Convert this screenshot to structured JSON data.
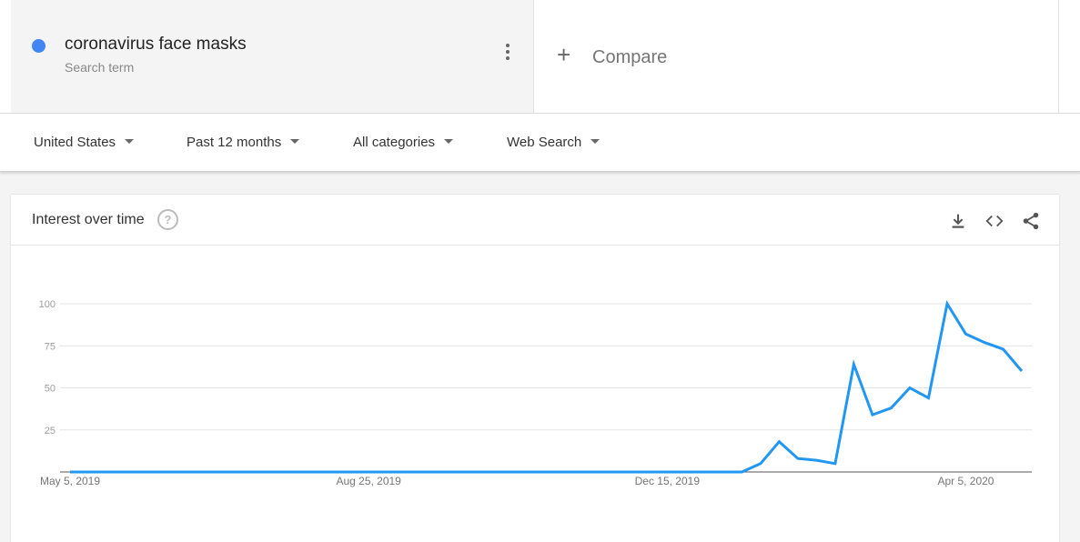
{
  "term": {
    "name": "coronavirus face masks",
    "sublabel": "Search term",
    "color": "#4285f4"
  },
  "compare": {
    "plus": "+",
    "label": "Compare"
  },
  "filters": [
    {
      "label": "United States"
    },
    {
      "label": "Past 12 months"
    },
    {
      "label": "All categories"
    },
    {
      "label": "Web Search"
    }
  ],
  "card": {
    "title": "Interest over time",
    "help_icon": "?",
    "icons": [
      "download-icon",
      "embed-code-icon",
      "share-icon"
    ]
  },
  "chart_data": {
    "type": "line",
    "title": "",
    "xlabel": "",
    "ylabel": "",
    "ylim": [
      0,
      100
    ],
    "yticks": [
      25,
      50,
      75,
      100
    ],
    "grid": true,
    "line_color": "#2196f3",
    "x_tick_labels": [
      {
        "label": "May 5, 2019",
        "index": 0
      },
      {
        "label": "Aug 25, 2019",
        "index": 16
      },
      {
        "label": "Dec 15, 2019",
        "index": 32
      },
      {
        "label": "Apr 5, 2020",
        "index": 48
      }
    ],
    "series": [
      {
        "values": [
          0,
          0,
          0,
          0,
          0,
          0,
          0,
          0,
          0,
          0,
          0,
          0,
          0,
          0,
          0,
          0,
          0,
          0,
          0,
          0,
          0,
          0,
          0,
          0,
          0,
          0,
          0,
          0,
          0,
          0,
          0,
          0,
          0,
          0,
          0,
          0,
          0,
          5,
          18,
          8,
          7,
          5,
          64,
          34,
          38,
          50,
          44,
          100,
          82,
          77,
          73,
          60
        ]
      }
    ]
  }
}
